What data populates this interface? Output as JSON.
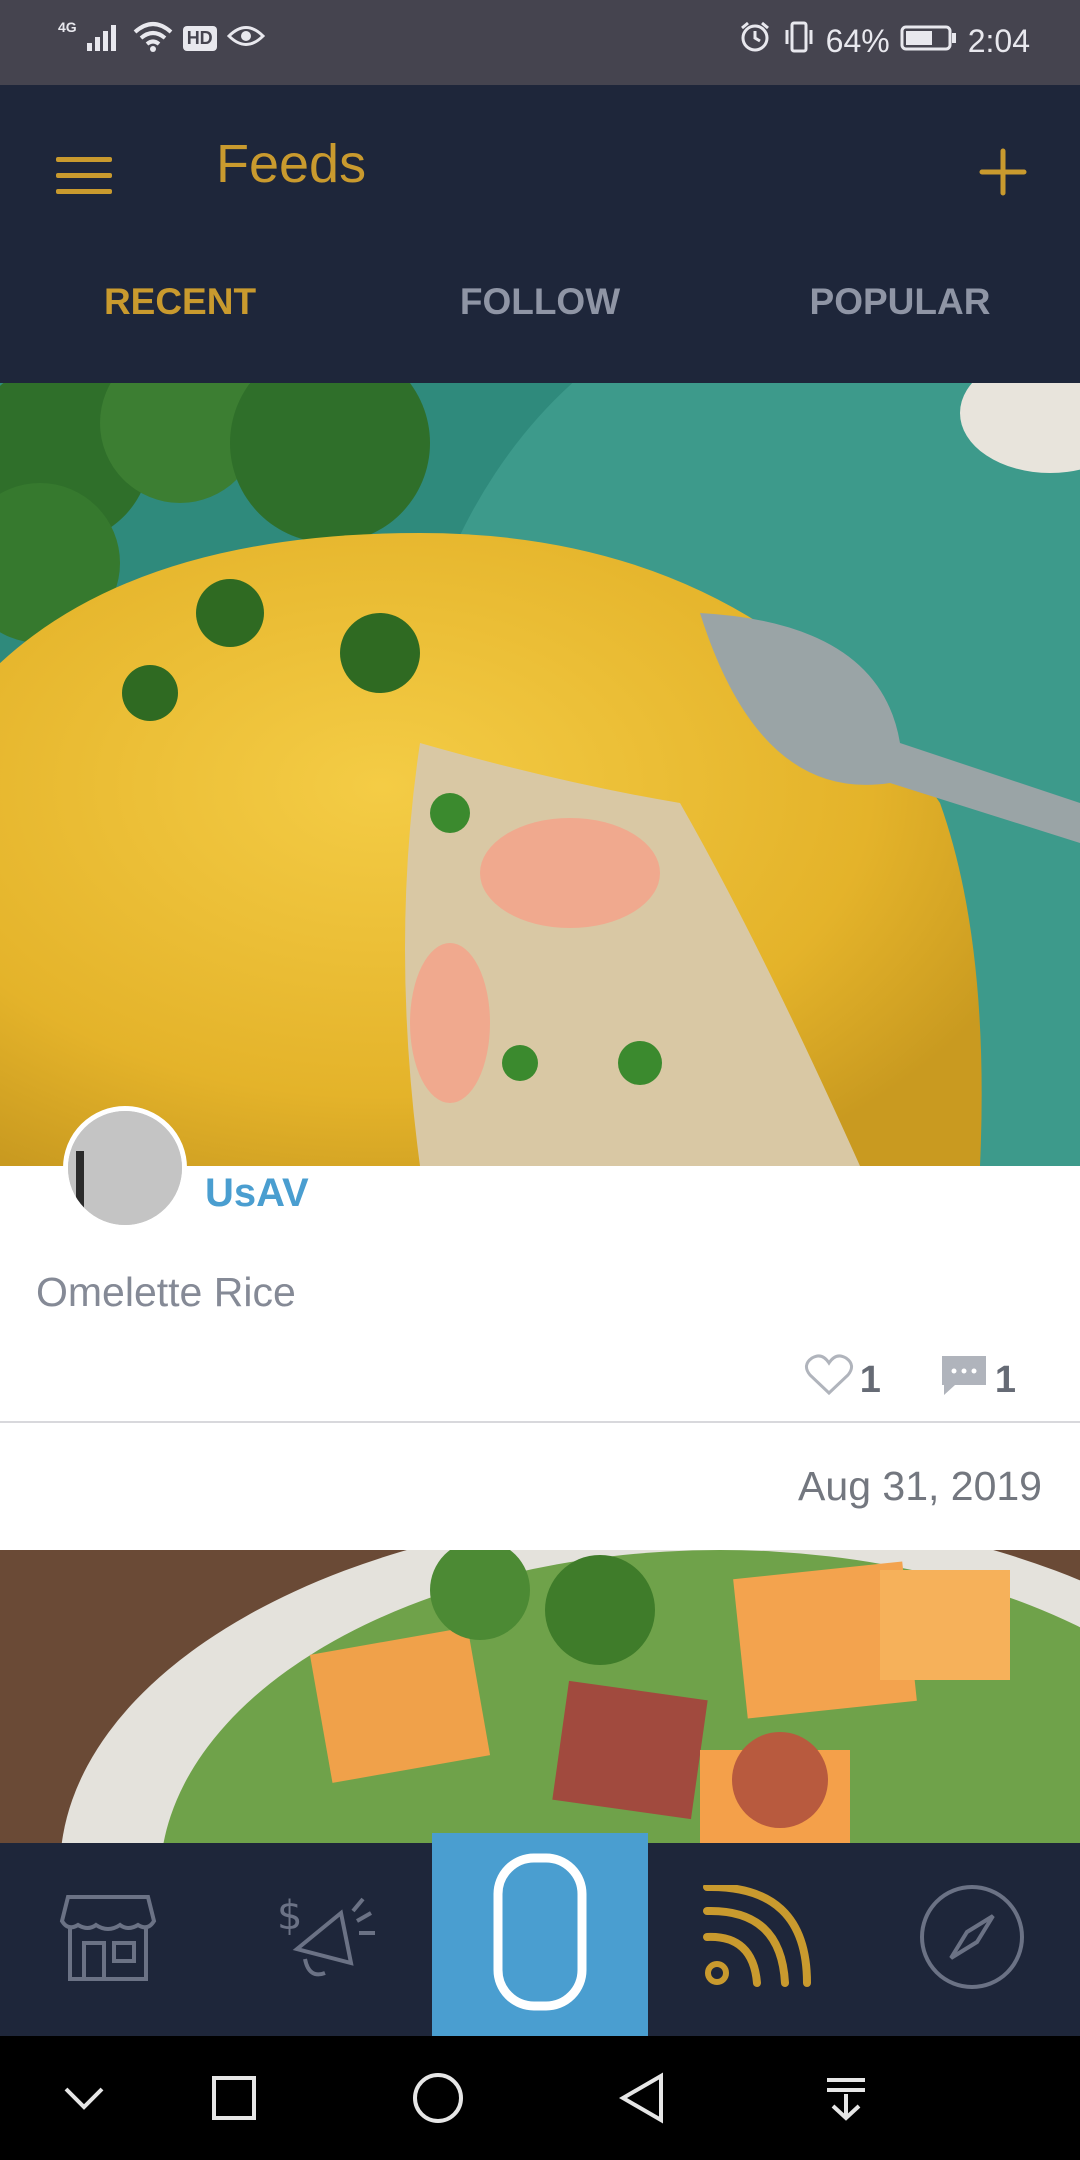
{
  "status_bar": {
    "network": "4G",
    "hd_badge": "HD",
    "battery_percent": "64%",
    "time": "2:04",
    "battery_level": 0.64
  },
  "header": {
    "title": "Feeds",
    "menu_icon": "hamburger-menu-icon",
    "add_icon": "plus-icon"
  },
  "tabs": [
    {
      "label": "RECENT",
      "active": true
    },
    {
      "label": "FOLLOW",
      "active": false
    },
    {
      "label": "POPULAR",
      "active": false
    }
  ],
  "posts": [
    {
      "username": "UsAV",
      "title": "Omelette Rice",
      "likes": "1",
      "comments": "1",
      "date": "Aug 31, 2019"
    }
  ],
  "bottom_nav": [
    {
      "icon": "store-icon",
      "active": false
    },
    {
      "icon": "promotion-megaphone-icon",
      "active": false
    },
    {
      "icon": "phone-icon",
      "active": false
    },
    {
      "icon": "feed-rss-icon",
      "active": true
    },
    {
      "icon": "compass-icon",
      "active": false
    }
  ],
  "system_nav": [
    {
      "icon": "chevron-down-icon"
    },
    {
      "icon": "recent-apps-square-icon"
    },
    {
      "icon": "home-circle-icon"
    },
    {
      "icon": "back-triangle-icon"
    },
    {
      "icon": "notification-pull-down-icon"
    }
  ],
  "colors": {
    "header_bg": "#1e263a",
    "accent_gold": "#c99a2e",
    "accent_blue": "#4a9ed0",
    "inactive_tab": "#8f95a5",
    "status_bar_bg": "#45444f"
  }
}
